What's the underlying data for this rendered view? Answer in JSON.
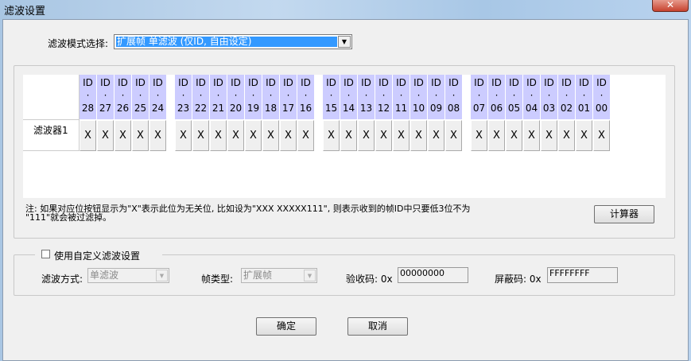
{
  "window": {
    "title": "滤波设置",
    "close_icon": "close-icon"
  },
  "mode": {
    "label": "滤波模式选择:",
    "value": "扩展帧 单滤波 (仅ID, 自由设定)"
  },
  "table": {
    "groups": [
      [
        "28",
        "27",
        "26",
        "25",
        "24"
      ],
      [
        "23",
        "22",
        "21",
        "20",
        "19",
        "18",
        "17",
        "16"
      ],
      [
        "15",
        "14",
        "13",
        "12",
        "11",
        "10",
        "09",
        "08"
      ],
      [
        "07",
        "06",
        "05",
        "04",
        "03",
        "02",
        "01",
        "00"
      ]
    ],
    "header_prefix": "ID",
    "row_label": "滤波器1",
    "cell_value": "X"
  },
  "note": {
    "line1": "注: 如果对应位按钮显示为\"X\"表示此位为无关位, 比如设为\"XXX XXXXX111\", 则表示收到的帧ID中只要低3位不为",
    "line2": "\"111\"就会被过滤掉。"
  },
  "calculator_label": "计算器",
  "custom": {
    "checkbox_label": "使用自定义滤波设置",
    "checked": false,
    "filter_mode_label": "滤波方式:",
    "filter_mode_value": "单滤波",
    "frame_type_label": "帧类型:",
    "frame_type_value": "扩展帧",
    "acc_label": "验收码: 0x",
    "acc_value": "00000000",
    "mask_label": "屏蔽码: 0x",
    "mask_value": "FFFFFFFF"
  },
  "ok_label": "确定",
  "cancel_label": "取消"
}
